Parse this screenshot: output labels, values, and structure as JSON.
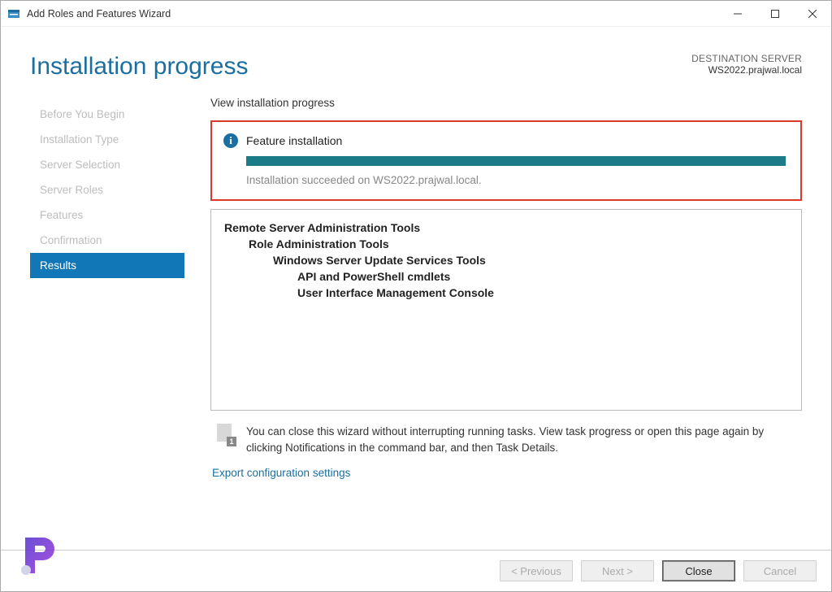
{
  "window": {
    "title": "Add Roles and Features Wizard"
  },
  "header": {
    "heading": "Installation progress",
    "destination_label": "DESTINATION SERVER",
    "destination_server": "WS2022.prajwal.local"
  },
  "sidebar": {
    "steps": [
      "Before You Begin",
      "Installation Type",
      "Server Selection",
      "Server Roles",
      "Features",
      "Confirmation",
      "Results"
    ],
    "active_index": 6
  },
  "content": {
    "section_label": "View installation progress",
    "status": {
      "title": "Feature installation",
      "progress_pct": 100,
      "message": "Installation succeeded on WS2022.prajwal.local."
    },
    "details_tree": {
      "l0": "Remote Server Administration Tools",
      "l1": "Role Administration Tools",
      "l2": "Windows Server Update Services Tools",
      "l3a": "API and PowerShell cmdlets",
      "l3b": "User Interface Management Console"
    },
    "hint": "You can close this wizard without interrupting running tasks. View task progress or open this page again by clicking Notifications in the command bar, and then Task Details.",
    "export_link": "Export configuration settings"
  },
  "footer": {
    "previous": "< Previous",
    "next": "Next >",
    "close": "Close",
    "cancel": "Cancel"
  },
  "colors": {
    "accent": "#1b6fa0",
    "highlight_border": "#d93a2b",
    "progress_fill": "#1b7b87",
    "sidebar_active": "#1177b7"
  }
}
